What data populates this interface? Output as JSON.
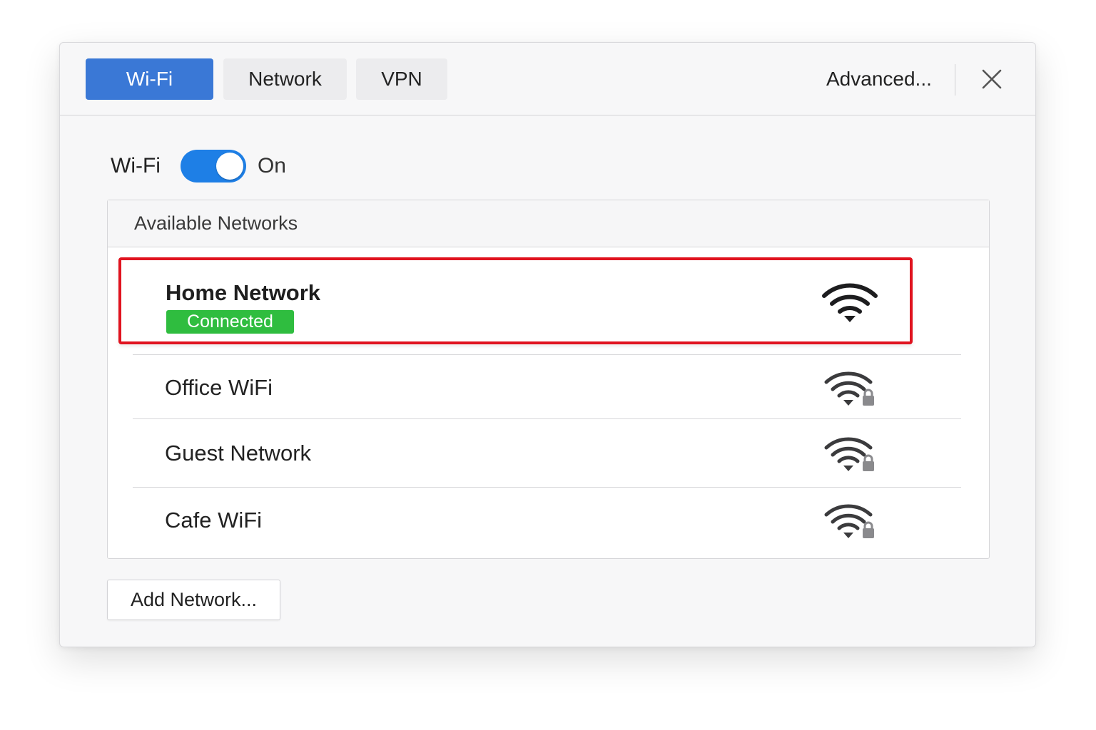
{
  "toolbar": {
    "tabs": [
      {
        "label": "Wi-Fi",
        "active": true
      },
      {
        "label": "Network",
        "active": false
      },
      {
        "label": "VPN",
        "active": false
      }
    ],
    "advanced_label": "Advanced...",
    "close_icon": "close-icon"
  },
  "wifi": {
    "label": "Wi-Fi",
    "state_label": "On",
    "enabled": true
  },
  "networks": {
    "header": "Available Networks",
    "items": [
      {
        "name": "Home Network",
        "status": "Connected",
        "secured": false,
        "icon": "wifi-strong-icon",
        "highlighted": true
      },
      {
        "name": "Office WiFi",
        "secured": true,
        "icon": "wifi-locked-icon"
      },
      {
        "name": "Guest Network",
        "secured": true,
        "icon": "wifi-locked-icon"
      },
      {
        "name": "Cafe WiFi",
        "secured": true,
        "icon": "wifi-locked-icon"
      }
    ]
  },
  "add_network_label": "Add Network...",
  "colors": {
    "accent": "#3a78d6",
    "toggle_on": "#1e7fe6",
    "connected_badge": "#2fbd3f",
    "highlight_border": "#e0131f"
  }
}
